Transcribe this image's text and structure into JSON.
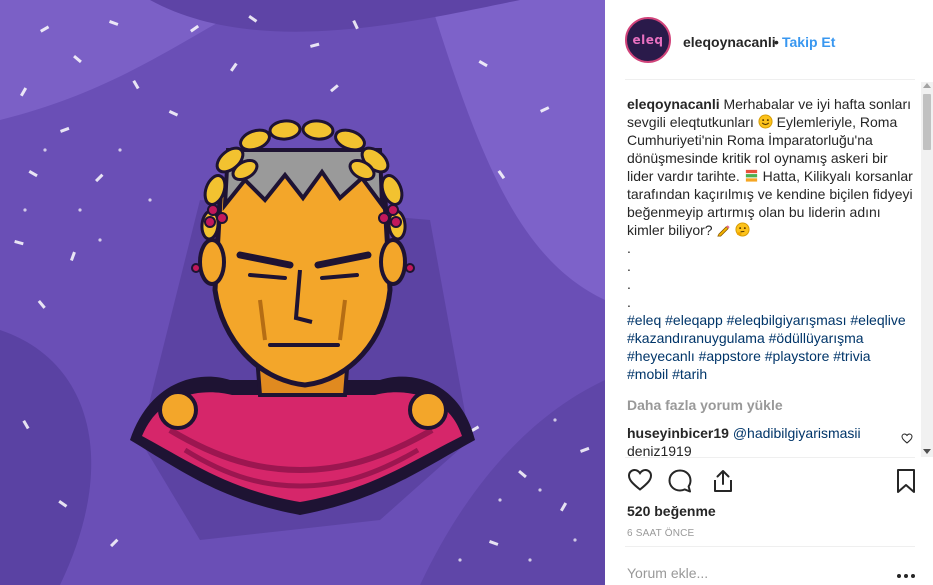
{
  "post": {
    "image_alt": "Roma imparatoru illüstrasyonu",
    "colors": {
      "background": "#6a4fb6",
      "laurel": "#f2c230",
      "face": "#f3a62a",
      "toga": "#d6266a"
    }
  },
  "header": {
    "avatar_text": "eleq",
    "username": "eleqoynacanli",
    "separator": "•",
    "follow_label": "Takip Et"
  },
  "caption": {
    "username": "eleqoynacanli",
    "text_1": "Merhabalar ve iyi hafta sonları sevgili eleqtutkunları",
    "text_2": "Eylemleriyle, Roma Cumhuriyeti'nin Roma İmparatorluğu'na dönüşmesinde kritik rol oynamış askeri bir lider vardır tarihte.",
    "text_3": "Hatta, Kilikyalı korsanlar tarafından kaçırılmış ve kendine biçilen fidyeyi beğenmeyip artırmış olan bu liderin adını kimler biliyor?",
    "dots": [
      ".",
      ".",
      ".",
      "."
    ],
    "hashtags": "#eleq #eleqapp #eleqbilgiyarışması #eleqlive #kazandıranuygulama #ödüllüyarışma #heyecanlı #appstore #playstore #trivia #mobil #tarih"
  },
  "load_more_label": "Daha fazla yorum yükle",
  "comments": [
    {
      "username": "huseyinbicer19",
      "mention": "@hadibilgiyarismasii",
      "cut_text": "deniz1919"
    }
  ],
  "icons": [
    "heart-icon",
    "comment-icon",
    "share-icon",
    "bookmark-icon",
    "more-icon"
  ],
  "likes_label": "520 beğenme",
  "time_label": "6 SAAT ÖNCE",
  "comment_placeholder": "Yorum ekle..."
}
